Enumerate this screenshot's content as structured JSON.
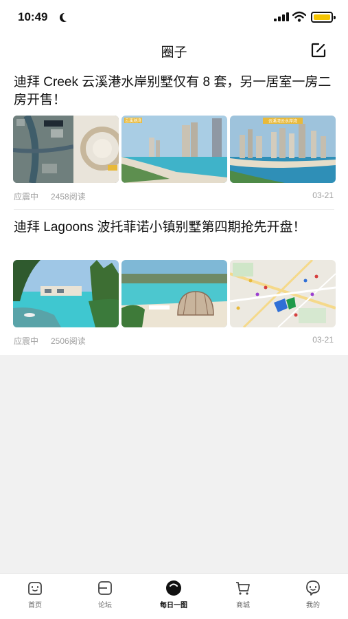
{
  "status_bar": {
    "time": "10:49"
  },
  "nav": {
    "title": "圈子"
  },
  "posts": [
    {
      "title": "迪拜 Creek 云溪港水岸别墅仅有 8 套，另一居室一房二房开售！",
      "author": "应震中",
      "views": "2458阅读",
      "date": "03-21",
      "thumb_badges": [
        "",
        "云溪港湾",
        "云溪湾云水岸湾"
      ]
    },
    {
      "title": "迪拜 Lagoons 波托菲诺小镇别墅第四期抢先开盘！",
      "author": "应震中",
      "views": "2506阅读",
      "date": "03-21",
      "thumb_badges": [
        "",
        "",
        ""
      ]
    }
  ],
  "tabbar": {
    "items": [
      {
        "label": "首页",
        "icon": "home-icon",
        "active": false
      },
      {
        "label": "论坛",
        "icon": "forum-icon",
        "active": false
      },
      {
        "label": "每日一图",
        "icon": "daily-image-icon",
        "active": true
      },
      {
        "label": "商城",
        "icon": "cart-icon",
        "active": false
      },
      {
        "label": "我的",
        "icon": "profile-icon",
        "active": false
      }
    ]
  },
  "colors": {
    "battery": "#f5c400",
    "background": "#f1f1f1",
    "meta_text": "#a0a0a0"
  }
}
